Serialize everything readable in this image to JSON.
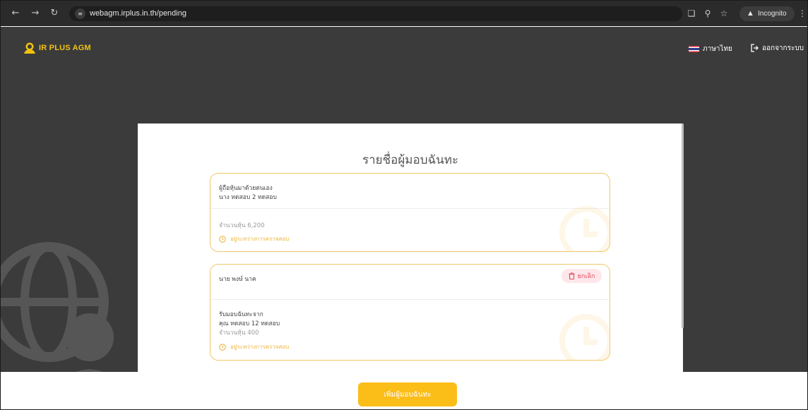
{
  "browser": {
    "url": "webagm.irplus.in.th/pending",
    "incognito_label": "Incognito"
  },
  "header": {
    "brand": "IR PLUS AGM",
    "language_label": "ภาษาไทย",
    "logout_label": "ออกจากระบบ"
  },
  "main": {
    "title": "รายชื่อผู้มอบฉันทะ",
    "cards": [
      {
        "type_label": "ผู้ถือหุ้นมาด้วยตนเอง",
        "name": "นาง ทดสอบ 2 ทดสอบ",
        "shares_label": "จำนวนหุ้น 6,200",
        "status": "อยู่ระหว่างการตรวจสอบ"
      },
      {
        "name": "นาย พงษ์ นาค",
        "cancel_label": "ยกเลิก",
        "received_label": "รับมอบฉันทะจาก",
        "from_name": "คุณ ทดสอบ 12 ทดสอบ",
        "shares_label": "จำนวนหุ้น 400",
        "status": "อยู่ระหว่างการตรวจสอบ"
      }
    ]
  },
  "footer": {
    "add_button_label": "เพิ่มผู้มอบฉันทะ"
  },
  "colors": {
    "accent": "#fbbd18",
    "brand_yellow": "#f1c20f",
    "card_border": "#f2c86a",
    "status_text": "#f0b43c",
    "cancel_bg": "#fde7ea",
    "cancel_text": "#e5485b",
    "page_bg": "#3b3b3b"
  }
}
